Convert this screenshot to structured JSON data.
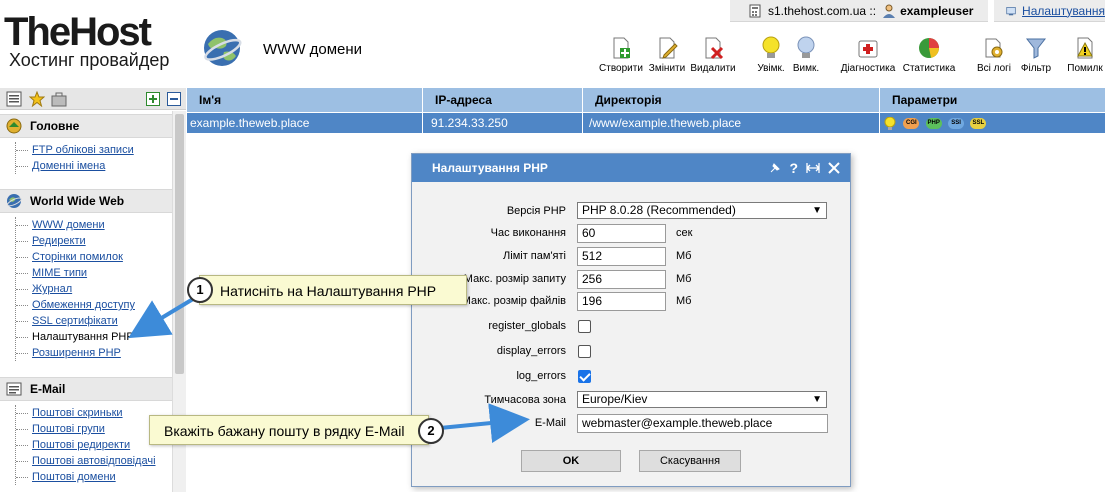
{
  "header": {
    "brand": "TheHost",
    "tagline": "Хостинг провайдер",
    "page_title": "WWW домени"
  },
  "topbar": {
    "server": "s1.thehost.com.ua ::",
    "user": "exampleuser",
    "settings_link": "Налаштування"
  },
  "toolbar": {
    "buttons": [
      {
        "label": "Створити",
        "icon": "create-icon"
      },
      {
        "label": "Змінити",
        "icon": "edit-icon"
      },
      {
        "label": "Видалити",
        "icon": "delete-icon"
      },
      {
        "label": "Увімк.",
        "icon": "bulb-on-icon"
      },
      {
        "label": "Вимк.",
        "icon": "bulb-off-icon"
      },
      {
        "label": "Діагностика",
        "icon": "diagnostics-icon"
      },
      {
        "label": "Статистика",
        "icon": "stats-icon"
      },
      {
        "label": "Всі логі",
        "icon": "logs-icon"
      },
      {
        "label": "Фільтр",
        "icon": "filter-icon"
      },
      {
        "label": "Помилк",
        "icon": "errors-icon"
      }
    ]
  },
  "sidebar": {
    "sections": [
      {
        "title": "Головне",
        "items": [
          "FTP облікові записи",
          "Доменні імена"
        ]
      },
      {
        "title": "World Wide Web",
        "items": [
          "WWW домени",
          "Редиректи",
          "Сторінки помилок",
          "MIME типи",
          "Журнал",
          "Обмеження доступу",
          "SSL сертифікати",
          "Налаштування PHP",
          "Розширення PHP"
        ],
        "current": "Налаштування PHP"
      },
      {
        "title": "E-Mail",
        "items": [
          "Поштові скриньки",
          "Поштові групи",
          "Поштові редиректи",
          "Поштові автовідповідачі",
          "Поштові домени"
        ]
      }
    ]
  },
  "table": {
    "columns": [
      "Ім'я",
      "IP-адреса",
      "Директорія",
      "Параметри"
    ],
    "rows": [
      {
        "name": "example.theweb.place",
        "ip": "91.234.33.250",
        "dir": "/www/example.theweb.place",
        "params": [
          "CGI",
          "PHP",
          "SSI",
          "SSL"
        ]
      }
    ]
  },
  "dialog": {
    "title": "Налаштування PHP",
    "fields": {
      "php_version": {
        "label": "Версія PHP",
        "value": "PHP 8.0.28 (Recommended)"
      },
      "exec_time": {
        "label": "Час виконання",
        "value": "60",
        "unit": "сек"
      },
      "memory_limit": {
        "label": "Ліміт пам'яті",
        "value": "512",
        "unit": "Мб"
      },
      "post_max": {
        "label": "Макс. розмір запиту",
        "value": "256",
        "unit": "Мб"
      },
      "upload_max": {
        "label": "Макс. розмір файлів",
        "value": "196",
        "unit": "Мб"
      },
      "register_globals": {
        "label": "register_globals",
        "checked": false
      },
      "display_errors": {
        "label": "display_errors",
        "checked": false
      },
      "log_errors": {
        "label": "log_errors",
        "checked": true
      },
      "timezone": {
        "label": "Тимчасова зона",
        "value": "Europe/Kiev"
      },
      "email": {
        "label": "E-Mail",
        "value": "webmaster@example.theweb.place"
      }
    },
    "ok_label": "OK",
    "cancel_label": "Скасування"
  },
  "callouts": [
    {
      "number": "1",
      "text": "Натисніть на Налаштування PHP"
    },
    {
      "number": "2",
      "text": "Вкажіть бажану пошту в рядку E-Mail"
    }
  ],
  "colors": {
    "header_blue": "#9dbfe3",
    "selected_row": "#4f86c6",
    "link": "#1b4fa0",
    "callout_bg": "#fafad2",
    "arrow": "#3d8bd9"
  }
}
